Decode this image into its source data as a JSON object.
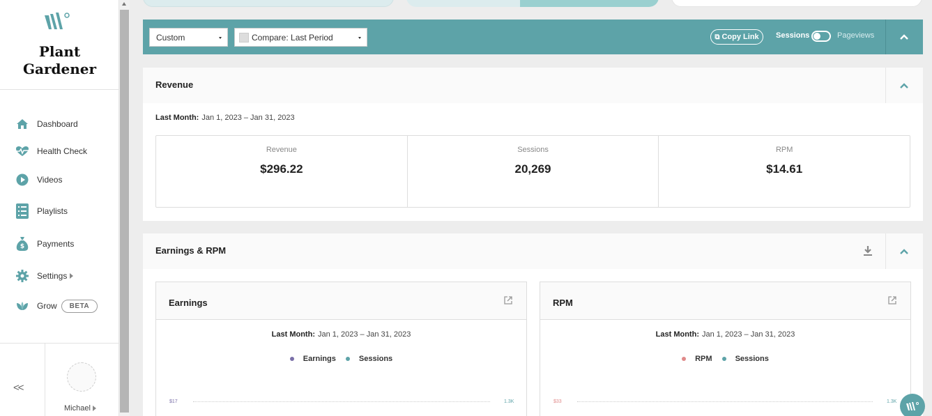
{
  "brand": {
    "name_line1": "Plant",
    "name_line2": "Gardener",
    "accent": "#5da3a8"
  },
  "sidebar": {
    "items": [
      {
        "label": "Dashboard",
        "icon": "home-icon"
      },
      {
        "label": "Health Check",
        "icon": "heartbeat-icon"
      },
      {
        "label": "Videos",
        "icon": "play-circle-icon"
      },
      {
        "label": "Playlists",
        "icon": "list-icon"
      },
      {
        "label": "Payments",
        "icon": "money-bag-icon"
      },
      {
        "label": "Settings",
        "icon": "gear-icon"
      },
      {
        "label": "Grow",
        "icon": "leaf-icon",
        "badge": "BETA"
      }
    ],
    "collapse_label": "<<",
    "user_name": "Michael"
  },
  "filterbar": {
    "range_select": "Custom",
    "compare_select": "Compare: Last Period",
    "copy_link": "Copy Link",
    "toggle_left": "Sessions",
    "toggle_right": "Pageviews"
  },
  "revenue": {
    "title": "Revenue",
    "range_label": "Last Month:",
    "range_value": "Jan 1, 2023 – Jan 31, 2023",
    "stats": [
      {
        "label": "Revenue",
        "value": "$296.22"
      },
      {
        "label": "Sessions",
        "value": "20,269"
      },
      {
        "label": "RPM",
        "value": "$14.61"
      }
    ]
  },
  "earnings_rpm": {
    "title": "Earnings & RPM",
    "cards": [
      {
        "title": "Earnings",
        "range_label": "Last Month:",
        "range_value": "Jan 1, 2023 – Jan 31, 2023",
        "legend": [
          {
            "label": "Earnings",
            "color": "#7a6fa8"
          },
          {
            "label": "Sessions",
            "color": "#5da3a8"
          }
        ],
        "y_left_top": "$17",
        "y_right_top": "1.3K"
      },
      {
        "title": "RPM",
        "range_label": "Last Month:",
        "range_value": "Jan 1, 2023 – Jan 31, 2023",
        "legend": [
          {
            "label": "RPM",
            "color": "#e08a8a"
          },
          {
            "label": "Sessions",
            "color": "#5da3a8"
          }
        ],
        "y_left_top": "$33",
        "y_right_top": "1.3K"
      }
    ]
  }
}
